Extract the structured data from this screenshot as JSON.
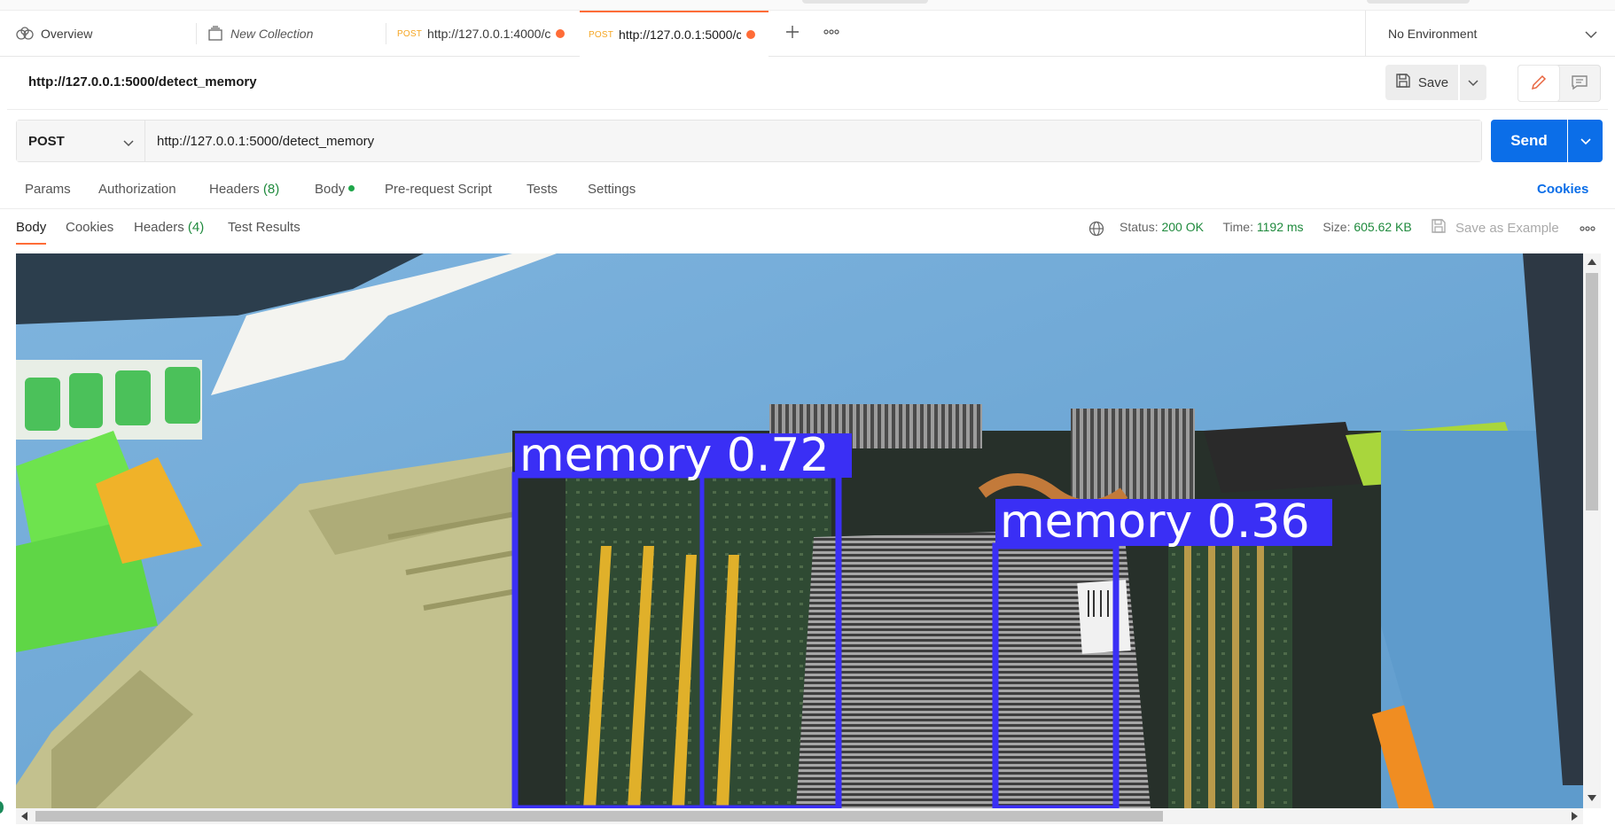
{
  "tabs": {
    "overview": "Overview",
    "collection": "New Collection",
    "request1": {
      "method": "POST",
      "url": "http://127.0.0.1:4000/c"
    },
    "request2": {
      "method": "POST",
      "url": "http://127.0.0.1:5000/c"
    }
  },
  "environment": {
    "label": "No Environment"
  },
  "request": {
    "title": "http://127.0.0.1:5000/detect_memory",
    "method": "POST",
    "url": "http://127.0.0.1:5000/detect_memory",
    "save_label": "Save",
    "send_label": "Send"
  },
  "request_tabs": {
    "params": "Params",
    "authorization": "Authorization",
    "headers": "Headers",
    "headers_count": "(8)",
    "body": "Body",
    "prerequest": "Pre-request Script",
    "tests": "Tests",
    "settings": "Settings",
    "cookies": "Cookies"
  },
  "response_tabs": {
    "body": "Body",
    "cookies": "Cookies",
    "headers": "Headers",
    "headers_count": "(4)",
    "test_results": "Test Results"
  },
  "response_status": {
    "status_label": "Status:",
    "status_value": "200 OK",
    "time_label": "Time:",
    "time_value": "1192 ms",
    "size_label": "Size:",
    "size_value": "605.62 KB",
    "save_example": "Save as Example"
  },
  "detections": [
    {
      "label": "memory 0.72"
    },
    {
      "label": "memory 0.36"
    }
  ],
  "colors": {
    "accent_orange": "#ff6c37",
    "send_blue": "#0b6ee8",
    "status_green": "#1f8a3d",
    "detection_box": "#3a2ff5"
  },
  "icons": [
    "overview-icon",
    "collection-icon",
    "plus-icon",
    "more-icon",
    "chevron-down-icon",
    "save-icon",
    "edit-icon",
    "comment-icon",
    "globe-icon",
    "save-example-icon"
  ]
}
